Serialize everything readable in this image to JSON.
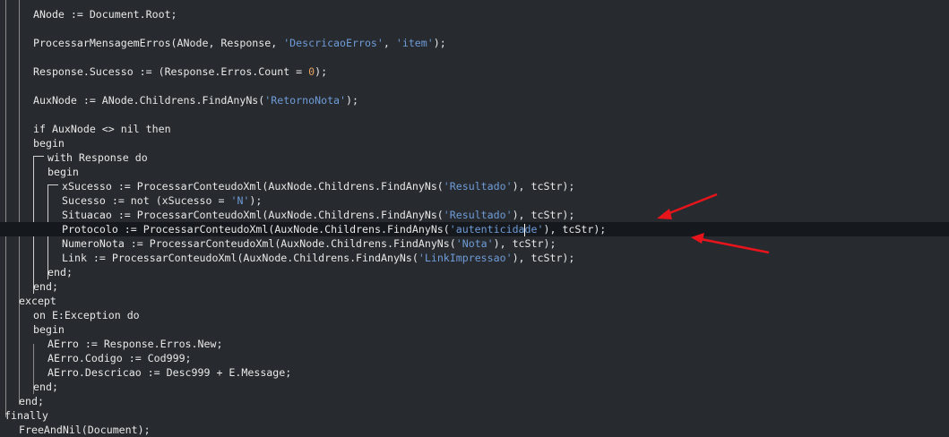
{
  "editor": {
    "lines": [
      {
        "i": 0,
        "segs": [
          {
            "t": "ANode := Document.Root;"
          }
        ]
      },
      {
        "i": 2,
        "segs": [
          {
            "t": "ProcessarMensagemErros(ANode, Response, "
          },
          {
            "t": "'DescricaoErros'",
            "c": "str"
          },
          {
            "t": ", "
          },
          {
            "t": "'item'",
            "c": "str"
          },
          {
            "t": ");"
          }
        ]
      },
      {
        "i": 4,
        "segs": [
          {
            "t": "Response.Sucesso := (Response.Erros.Count = "
          },
          {
            "t": "0",
            "c": "num"
          },
          {
            "t": ");"
          }
        ]
      },
      {
        "i": 6,
        "segs": [
          {
            "t": "AuxNode := ANode.Childrens.FindAnyNs("
          },
          {
            "t": "'RetornoNota'",
            "c": "str"
          },
          {
            "t": ");"
          }
        ]
      },
      {
        "i": 8,
        "segs": [
          {
            "t": "if AuxNode <> nil then"
          }
        ]
      },
      {
        "i": 9,
        "segs": [
          {
            "t": "begin"
          }
        ]
      },
      {
        "i": 10,
        "segs": [
          {
            "t": "with Response do"
          }
        ]
      },
      {
        "i": 11,
        "segs": [
          {
            "t": "begin"
          }
        ]
      },
      {
        "i": 12,
        "segs": [
          {
            "t": "xSucesso := ProcessarConteudoXml(AuxNode.Childrens.FindAnyNs("
          },
          {
            "t": "'Resultado'",
            "c": "str"
          },
          {
            "t": "), tcStr);"
          }
        ]
      },
      {
        "i": 13,
        "segs": [
          {
            "t": "Sucesso := not (xSucesso = "
          },
          {
            "t": "'N'",
            "c": "str"
          },
          {
            "t": ");"
          }
        ]
      },
      {
        "i": 14,
        "segs": [
          {
            "t": "Situacao := ProcessarConteudoXml(AuxNode.Childrens.FindAnyNs("
          },
          {
            "t": "'Resultado'",
            "c": "str"
          },
          {
            "t": "), tcStr);"
          }
        ]
      },
      {
        "i": 15,
        "current": true,
        "segs": [
          {
            "t": "Protocolo := ProcessarConteudoXml(AuxNode.Childrens.FindAnyNs("
          },
          {
            "t": "'autenticida",
            "c": "str"
          },
          {
            "caret": true
          },
          {
            "t": "de'",
            "c": "str"
          },
          {
            "t": "), tcStr);"
          }
        ]
      },
      {
        "i": 16,
        "segs": [
          {
            "t": "NumeroNota := ProcessarConteudoXml(AuxNode.Childrens.FindAnyNs("
          },
          {
            "t": "'Nota'",
            "c": "str"
          },
          {
            "t": "), tcStr);"
          }
        ]
      },
      {
        "i": 17,
        "segs": [
          {
            "t": "Link := ProcessarConteudoXml(AuxNode.Childrens.FindAnyNs("
          },
          {
            "t": "'LinkImpressao'",
            "c": "str"
          },
          {
            "t": "), tcStr);"
          }
        ]
      },
      {
        "i": 18,
        "segs": [
          {
            "t": "end;"
          }
        ]
      },
      {
        "i": 19,
        "segs": [
          {
            "t": "end;"
          }
        ]
      },
      {
        "i": 20,
        "segs": [
          {
            "t": "except"
          }
        ]
      },
      {
        "i": 21,
        "segs": [
          {
            "t": "on E:Exception do"
          }
        ]
      },
      {
        "i": 22,
        "segs": [
          {
            "t": "begin"
          }
        ]
      },
      {
        "i": 23,
        "segs": [
          {
            "t": "AErro := Response.Erros.New;"
          }
        ]
      },
      {
        "i": 24,
        "segs": [
          {
            "t": "AErro.Codigo := Cod999;"
          }
        ]
      },
      {
        "i": 25,
        "segs": [
          {
            "t": "AErro.Descricao := Desc999 + E.Message;"
          }
        ]
      },
      {
        "i": 26,
        "segs": [
          {
            "t": "end;"
          }
        ]
      },
      {
        "i": 27,
        "segs": [
          {
            "t": "end;"
          }
        ]
      },
      {
        "i": 28,
        "segs": [
          {
            "t": "finally"
          }
        ]
      },
      {
        "i": 29,
        "segs": [
          {
            "t": "FreeAndNil(Document);"
          }
        ]
      }
    ]
  },
  "annotation": {
    "arrow_color": "#e8141c"
  }
}
